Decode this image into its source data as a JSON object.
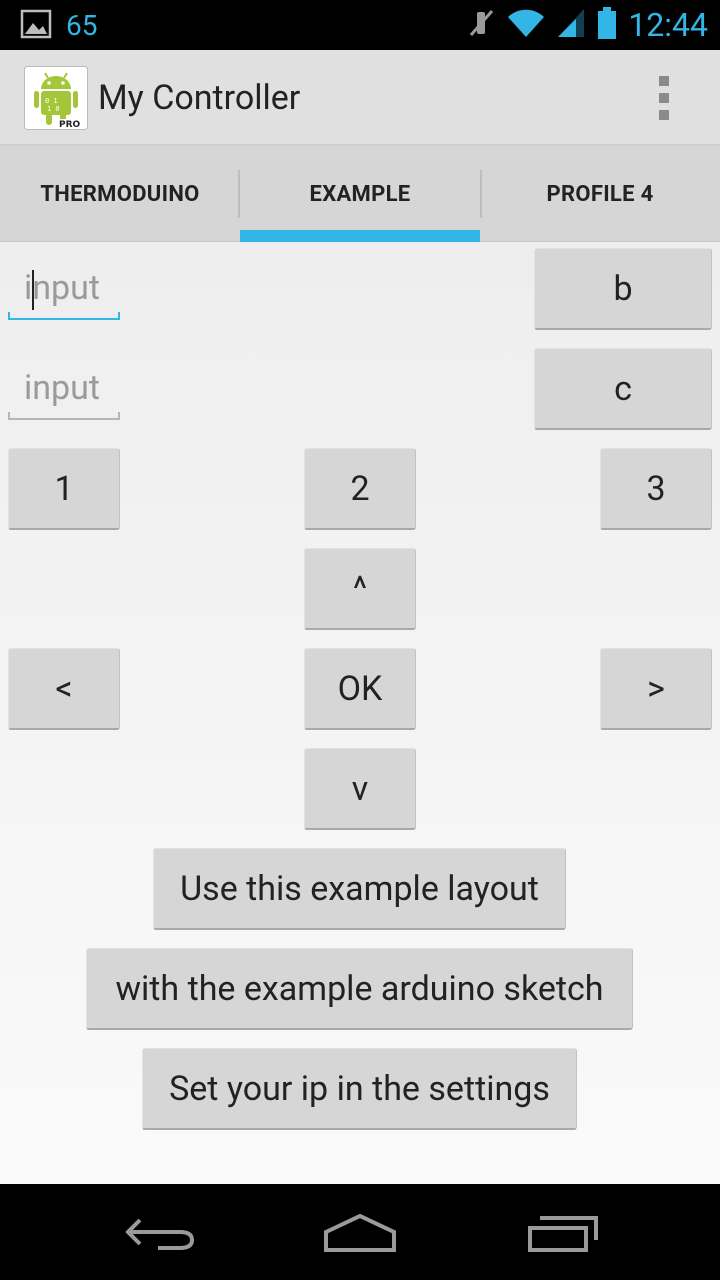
{
  "status_bar": {
    "notification_count": "65",
    "time": "12:44",
    "icons": [
      "image-notification-icon",
      "mute-icon",
      "wifi-icon",
      "signal-icon",
      "battery-icon"
    ],
    "accent_color": "#33b5e5"
  },
  "action_bar": {
    "title": "My Controller",
    "app_icon": "android-pro-icon",
    "menu_icon": "overflow-menu-icon"
  },
  "tabs": {
    "items": [
      {
        "label": "THERMODUINO"
      },
      {
        "label": "EXAMPLE"
      },
      {
        "label": "PROFILE 4"
      }
    ],
    "selected": "EXAMPLE",
    "indicator_color": "#33b5e5"
  },
  "controls": {
    "input1_placeholder": "input",
    "input2_placeholder": "input",
    "btn_b": "b",
    "btn_c": "c",
    "btn_1": "1",
    "btn_2": "2",
    "btn_3": "3",
    "btn_up": "^",
    "btn_left": "<",
    "btn_ok": "OK",
    "btn_right": ">",
    "btn_down": "v",
    "btn_text1": "Use this example layout",
    "btn_text2": "with the example arduino sketch",
    "btn_text3": "Set your ip in the settings"
  },
  "nav_bar": {
    "icons": [
      "back-icon",
      "home-icon",
      "recent-apps-icon"
    ]
  }
}
